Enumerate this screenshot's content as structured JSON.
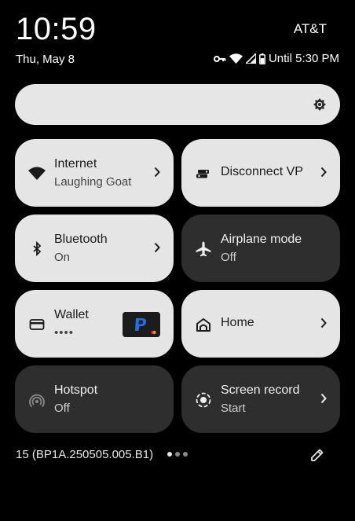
{
  "status_bar": {
    "time": "10:59",
    "carrier": "AT&T",
    "date": "Thu, May 8",
    "icons": [
      "vpn-key-icon",
      "wifi-icon",
      "signal-icon",
      "battery-icon"
    ],
    "battery_text": "Until 5:30 PM"
  },
  "brightness": {
    "icon": "brightness-icon"
  },
  "tiles": [
    {
      "title": "Internet",
      "subtitle": "Laughing Goat",
      "state": "on",
      "icon": "wifi-icon",
      "has_chevron": true
    },
    {
      "title": "Disconnect VPN",
      "subtitle": "",
      "state": "on",
      "icon": "vpn-icon",
      "has_chevron": true
    },
    {
      "title": "Bluetooth",
      "subtitle": "On",
      "state": "on",
      "icon": "bluetooth-icon",
      "has_chevron": true
    },
    {
      "title": "Airplane mode",
      "subtitle": "Off",
      "state": "off",
      "icon": "airplane-icon",
      "has_chevron": false
    },
    {
      "title": "Wallet",
      "subtitle": "••••",
      "state": "on",
      "icon": "wallet-icon",
      "has_chevron": false,
      "card": "paypal-card"
    },
    {
      "title": "Home",
      "subtitle": "",
      "state": "on",
      "icon": "home-icon",
      "has_chevron": true
    },
    {
      "title": "Hotspot",
      "subtitle": "Off",
      "state": "off",
      "icon": "hotspot-icon",
      "has_chevron": false
    },
    {
      "title": "Screen record",
      "subtitle": "Start",
      "state": "off",
      "icon": "screen-record-icon",
      "has_chevron": true
    }
  ],
  "footer": {
    "build": "15 (BP1A.250505.005.B1)",
    "page_index": 0,
    "page_count": 3,
    "edit_icon": "edit-icon"
  },
  "colors": {
    "background": "#000000",
    "tile_on": "#e5e5e5",
    "tile_off": "#2e2e2e",
    "paypal_blue": "#1e6fe8"
  }
}
